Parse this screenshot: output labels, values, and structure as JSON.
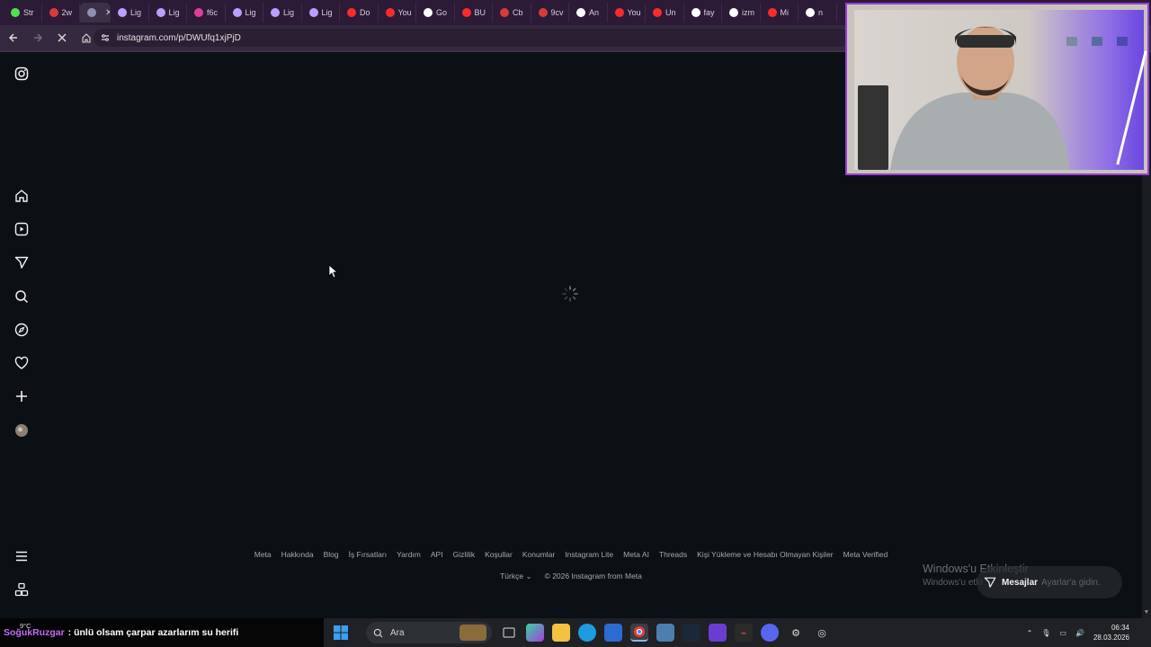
{
  "browser": {
    "tabs": [
      {
        "label": "Str",
        "color": "#52e052"
      },
      {
        "label": "2w",
        "color": "#d93a3a"
      },
      {
        "label": "",
        "color": "#8f8fb0",
        "active": true
      },
      {
        "label": "Lig",
        "color": "#b9a0ff"
      },
      {
        "label": "Lig",
        "color": "#b9a0ff"
      },
      {
        "label": "f6c",
        "color": "#e23e97"
      },
      {
        "label": "Lig",
        "color": "#b9a0ff"
      },
      {
        "label": "Lig",
        "color": "#b9a0ff"
      },
      {
        "label": "Lig",
        "color": "#b9a0ff"
      },
      {
        "label": "Do",
        "color": "#ff2a2a"
      },
      {
        "label": "You",
        "color": "#ff2a2a"
      },
      {
        "label": "Go",
        "color": "#ffffff"
      },
      {
        "label": "BU",
        "color": "#ff2a2a"
      },
      {
        "label": "Cb",
        "color": "#d93a3a"
      },
      {
        "label": "9cv",
        "color": "#d93a3a"
      },
      {
        "label": "An",
        "color": "#ffffff"
      },
      {
        "label": "You",
        "color": "#ff2a2a"
      },
      {
        "label": "Un",
        "color": "#ff2a2a"
      },
      {
        "label": "fay",
        "color": "#ffffff"
      },
      {
        "label": "izm",
        "color": "#ffffff"
      },
      {
        "label": "Mi",
        "color": "#ff2a2a"
      },
      {
        "label": "n",
        "color": "#ffffff"
      }
    ],
    "url": "instagram.com/p/DWUfq1xjPjD"
  },
  "sidebar": {
    "icons": [
      "instagram-logo-icon",
      "home-icon",
      "reels-icon",
      "messages-icon",
      "search-icon",
      "explore-icon",
      "notifications-icon",
      "create-icon",
      "profile-avatar",
      "more-menu-icon",
      "also-from-meta-icon"
    ]
  },
  "footer": {
    "links": [
      "Meta",
      "Hakkında",
      "Blog",
      "İş Fırsatları",
      "Yardım",
      "API",
      "Gizlilik",
      "Koşullar",
      "Konumlar",
      "Instagram Lite",
      "Meta AI",
      "Threads",
      "Kişi Yükleme ve Hesabı Olmayan Kişiler",
      "Meta Verified"
    ],
    "language": "Türkçe",
    "copyright": "© 2026 Instagram from Meta"
  },
  "overlay": {
    "activate_title": "Windows'u Etkinleştir",
    "activate_sub": "Windows'u etki",
    "activate_tail": "Ayarlar'a gidin.",
    "messages_label": "Mesajlar"
  },
  "ticker": {
    "weather": "9°C",
    "user": "SoğukRuzgar",
    "message": ": ünlü olsam çarpar azarlarım su herifi"
  },
  "taskbar": {
    "search_placeholder": "Ara",
    "time": "06:34",
    "date": "28.03.2026"
  },
  "colors": {
    "page_bg": "#0b1014",
    "tab_strip": "#2b1b36",
    "webcam_border": "#9b3cd8",
    "ticker_name": "#c26cf5"
  }
}
